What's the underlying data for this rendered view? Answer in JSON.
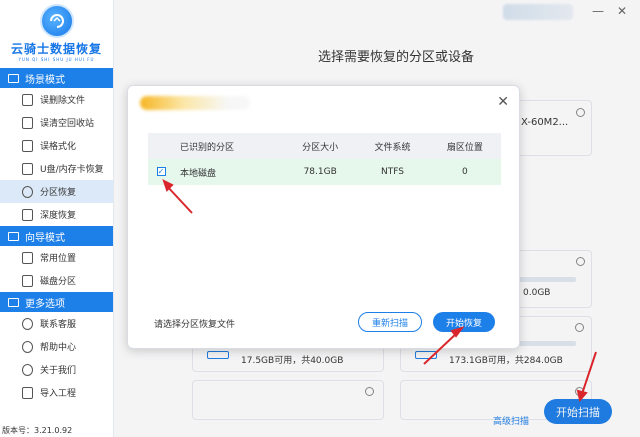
{
  "app": {
    "logo_text": "云骑士数据恢复",
    "logo_subtext": "YUN QI SHI SHU JU HUI FU",
    "version": "版本号：3.21.0.92"
  },
  "sidebar": {
    "sections": [
      {
        "title": "场景模式",
        "items": [
          {
            "label": "误删除文件"
          },
          {
            "label": "误清空回收站"
          },
          {
            "label": "误格式化"
          },
          {
            "label": "U盘/内存卡恢复"
          },
          {
            "label": "分区恢复",
            "active": true
          },
          {
            "label": "深度恢复"
          }
        ]
      },
      {
        "title": "向导模式",
        "items": [
          {
            "label": "常用位置"
          },
          {
            "label": "磁盘分区"
          }
        ]
      },
      {
        "title": "更多选项",
        "items": [
          {
            "label": "联系客服"
          },
          {
            "label": "帮助中心"
          },
          {
            "label": "关于我们"
          },
          {
            "label": "导入工程"
          }
        ]
      }
    ]
  },
  "window": {
    "minimize": "—",
    "close": "✕"
  },
  "main": {
    "title": "选择需要恢复的分区或设备",
    "cards": [
      {
        "text": "X-60M2..."
      },
      {
        "text": "0.0GB"
      },
      {
        "text": "17.5GB可用，共40.0GB"
      },
      {
        "text": "173.1GB可用，共284.0GB"
      }
    ],
    "advanced_scan": "高级扫描",
    "start_scan": "开始扫描"
  },
  "dialog": {
    "close": "✕",
    "headers": [
      "已识别的分区",
      "分区大小",
      "文件系统",
      "扇区位置"
    ],
    "rows": [
      {
        "checked": true,
        "name": "本地磁盘",
        "size": "78.1GB",
        "fs": "NTFS",
        "sector": "0"
      }
    ],
    "hint": "请选择分区恢复文件",
    "rescan": "重新扫描",
    "recover": "开始恢复"
  },
  "colors": {
    "accent": "#1d7fe8",
    "row_selected": "#e6f7ec",
    "arrow": "#d9262c"
  }
}
